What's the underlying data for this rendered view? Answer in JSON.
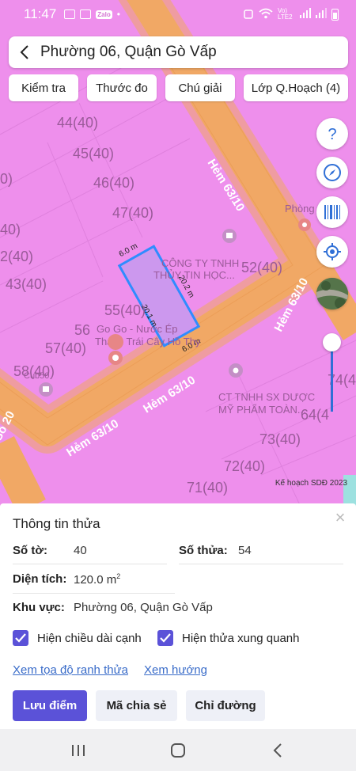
{
  "status": {
    "time": "11:47",
    "dot": "•",
    "zalo": "Zalo",
    "net": "Vo) LTE2"
  },
  "header": {
    "title": "Phường 06, Quận Gò Vấp"
  },
  "toolbar": {
    "check": "Kiểm tra",
    "ruler": "Thước đo",
    "legend": "Chú giải",
    "layers": "Lớp Q.Hoạch (4)"
  },
  "map": {
    "parcels": [
      "44(40)",
      "45(40)",
      "46(40)",
      "47(40)",
      "43(40)",
      "55(40)",
      "56",
      "57(40)",
      "58(40)",
      "73(40)",
      "72(40)",
      "71(40)",
      "52(40)",
      "74(4",
      "40)",
      "0)",
      "2(40)",
      "64(4"
    ],
    "roads": [
      "Hẻm 63/10",
      "Hẻm 63/10",
      "Hẻm 63/10",
      "Hẻm 63/10",
      "Số 20"
    ],
    "poi": [
      "CÔNG TY TNHH",
      "THỦY TIN HỌC...",
      "Go Go - Nước Ép",
      "Thạch Trái Cây Hồ Thy",
      "CT TNHH SX DƯỢC",
      "MỸ PHẨM TOÀN...",
      "Phòng",
      "Cub50"
    ],
    "edges": [
      "6.0 m",
      "20.2 m",
      "20.1 m",
      "6.0 m"
    ],
    "credit": "Kế hoạch SDĐ 2023"
  },
  "panel": {
    "title": "Thông tin thửa",
    "sheet_label": "Số tờ:",
    "sheet_value": "40",
    "plot_label": "Số thửa:",
    "plot_value": "54",
    "area_label": "Diện tích:",
    "area_value": "120.0 m",
    "area_unit_sup": "2",
    "region_label": "Khu vực:",
    "region_value": "Phường 06, Quận Gò Vấp",
    "cb_edges": "Hiện chiều dài cạnh",
    "cb_neighbors": "Hiện thửa xung quanh",
    "link_coords": "Xem tọa độ ranh thửa",
    "link_direction": "Xem hướng",
    "btn_save": "Lưu điểm",
    "btn_share": "Mã chia sẻ",
    "btn_route": "Chỉ đường"
  },
  "colors": {
    "map_bg": "#ee8fec",
    "road": "#f1a865",
    "accent": "#5b52d8",
    "link": "#3a6cc9"
  }
}
